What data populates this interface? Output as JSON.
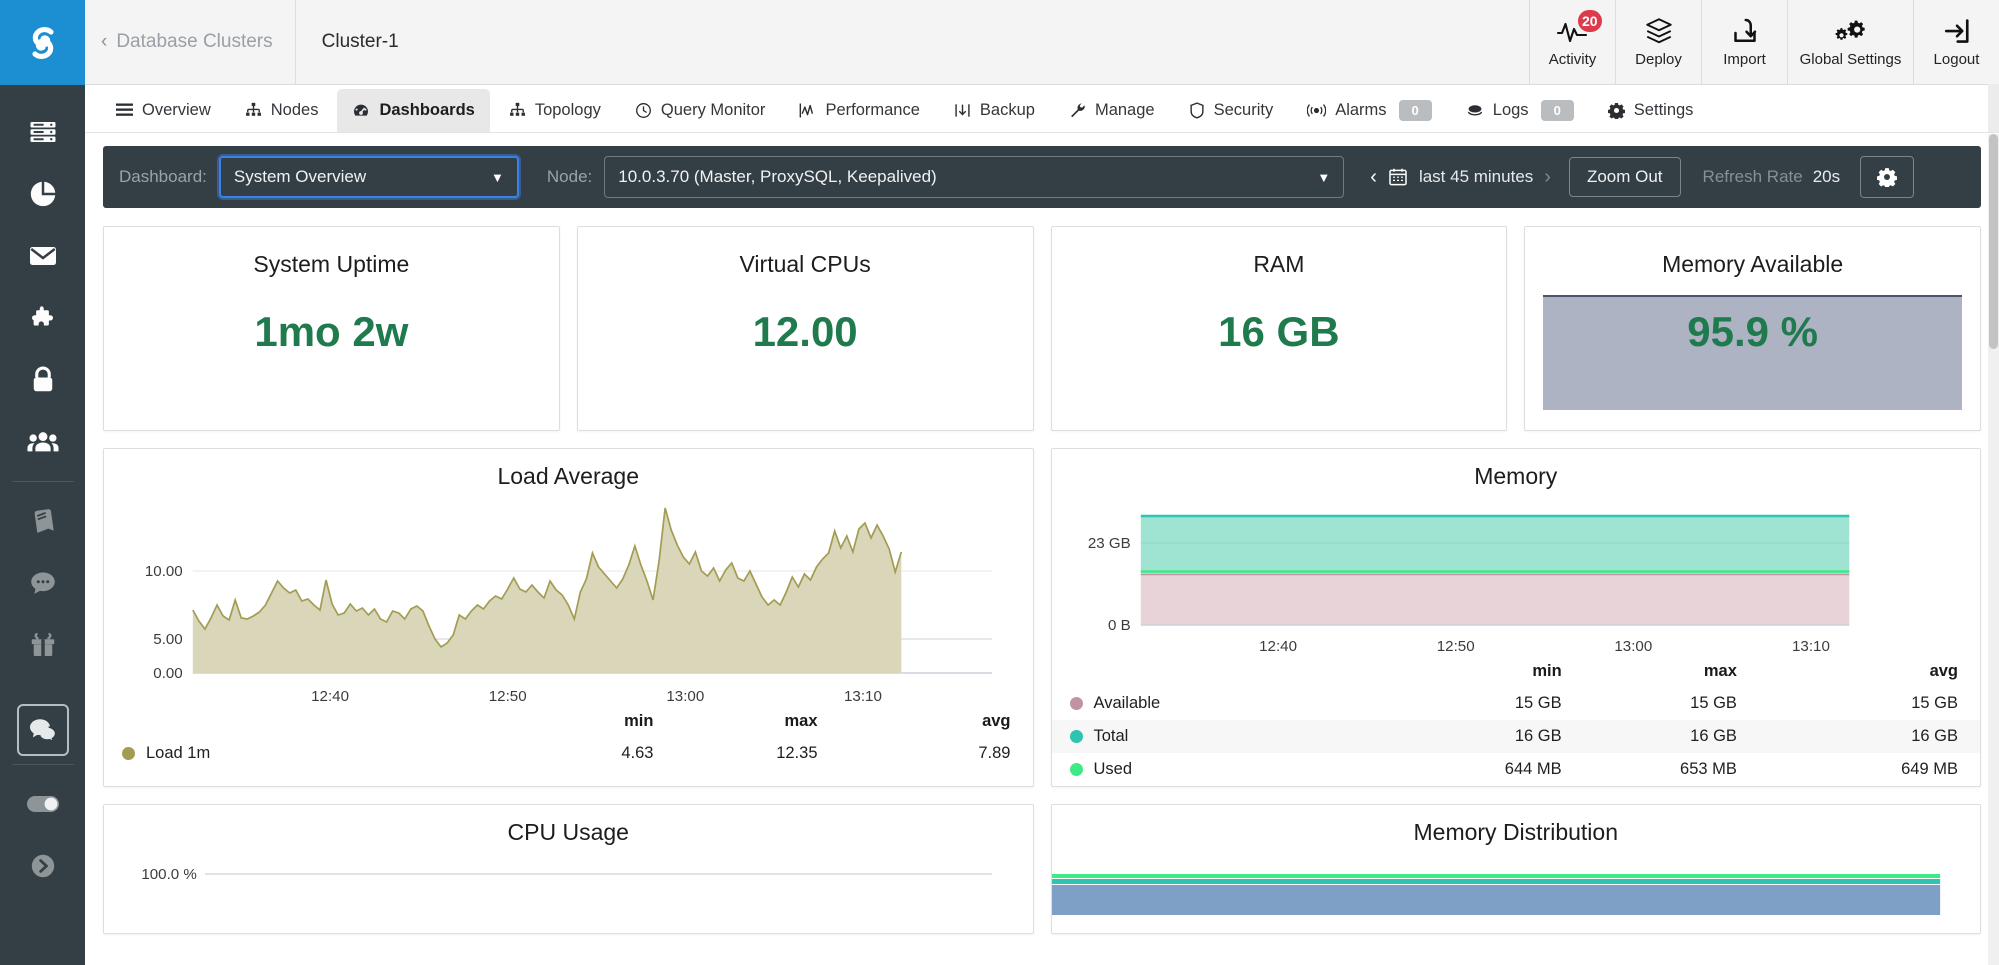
{
  "sidebar": {
    "logo_icon": "severalnines-logo-icon",
    "items": [
      {
        "icon": "database-server-icon",
        "name": "clusters"
      },
      {
        "icon": "pie-chart-icon",
        "name": "reports"
      },
      {
        "icon": "envelope-icon",
        "name": "email-notifications"
      },
      {
        "icon": "puzzle-piece-icon",
        "name": "integrations"
      },
      {
        "icon": "lock-icon",
        "name": "key-management"
      },
      {
        "icon": "users-icon",
        "name": "user-management"
      },
      {
        "icon": "book-icon",
        "name": "documentation"
      },
      {
        "icon": "comment-dots-icon",
        "name": "support"
      },
      {
        "icon": "gift-icon",
        "name": "whats-new"
      }
    ],
    "active_item": {
      "icon": "comments-icon",
      "name": "chat"
    },
    "bottom_items": [
      {
        "icon": "toggle-icon",
        "name": "theme-toggle"
      },
      {
        "icon": "chevron-right-circle-icon",
        "name": "expand-sidebar"
      }
    ]
  },
  "header": {
    "back_chevron": "‹",
    "breadcrumb_parent": "Database Clusters",
    "cluster_title": "Cluster-1",
    "actions": [
      {
        "label": "Activity",
        "icon": "activity-pulse-icon",
        "badge": "20"
      },
      {
        "label": "Deploy",
        "icon": "stack-layers-icon",
        "badge": ""
      },
      {
        "label": "Import",
        "icon": "import-download-icon",
        "badge": ""
      },
      {
        "label": "Global Settings",
        "icon": "gears-icon",
        "badge": ""
      },
      {
        "label": "Logout",
        "icon": "logout-arrow-icon",
        "badge": ""
      }
    ]
  },
  "nav": {
    "tabs": [
      {
        "label": "Overview",
        "icon": "list-icon",
        "active": false,
        "count": null
      },
      {
        "label": "Nodes",
        "icon": "sitemap-icon",
        "active": false,
        "count": null
      },
      {
        "label": "Dashboards",
        "icon": "dashboard-gauge-icon",
        "active": true,
        "count": null
      },
      {
        "label": "Topology",
        "icon": "topology-icon",
        "active": false,
        "count": null
      },
      {
        "label": "Query Monitor",
        "icon": "clock-icon",
        "active": false,
        "count": null
      },
      {
        "label": "Performance",
        "icon": "chart-line-icon",
        "active": false,
        "count": null
      },
      {
        "label": "Backup",
        "icon": "backup-download-icon",
        "active": false,
        "count": null
      },
      {
        "label": "Manage",
        "icon": "wrench-icon",
        "active": false,
        "count": null
      },
      {
        "label": "Security",
        "icon": "shield-icon",
        "active": false,
        "count": null
      },
      {
        "label": "Alarms",
        "icon": "broadcast-icon",
        "active": false,
        "count": "0"
      },
      {
        "label": "Logs",
        "icon": "logs-icon",
        "active": false,
        "count": "0"
      },
      {
        "label": "Settings",
        "icon": "gear-icon",
        "active": false,
        "count": null
      }
    ]
  },
  "controls": {
    "dashboard_label": "Dashboard:",
    "dashboard_value": "System Overview",
    "node_label": "Node:",
    "node_value": "10.0.3.70 (Master, ProxySQL, Keepalived)",
    "prev_arrow": "‹",
    "next_arrow": "›",
    "calendar_icon": "calendar-icon",
    "time_range": "last 45 minutes",
    "zoom_out_label": "Zoom Out",
    "refresh_rate_label": "Refresh Rate",
    "refresh_rate_value": "20s",
    "settings_icon": "gear-icon"
  },
  "stats": [
    {
      "title": "System Uptime",
      "value": "1mo 2w",
      "filled": false
    },
    {
      "title": "Virtual CPUs",
      "value": "12.00",
      "filled": false
    },
    {
      "title": "RAM",
      "value": "16 GB",
      "filled": false
    },
    {
      "title": "Memory Available",
      "value": "95.9 %",
      "filled": true
    }
  ],
  "panels": {
    "load_average": {
      "title": "Load Average",
      "columns": [
        "min",
        "max",
        "avg"
      ],
      "rows": [
        {
          "name": "Load 1m",
          "color": "#a39d53",
          "min": "4.63",
          "max": "12.35",
          "avg": "7.89"
        }
      ]
    },
    "memory": {
      "title": "Memory",
      "columns": [
        "min",
        "max",
        "avg"
      ],
      "rows": [
        {
          "name": "Available",
          "color": "#c194a5",
          "min": "15 GB",
          "max": "15 GB",
          "avg": "15 GB"
        },
        {
          "name": "Total",
          "color": "#2ec4b0",
          "min": "16 GB",
          "max": "16 GB",
          "avg": "16 GB"
        },
        {
          "name": "Used",
          "color": "#3ceb86",
          "min": "644 MB",
          "max": "653 MB",
          "avg": "649 MB"
        }
      ]
    },
    "cpu_usage": {
      "title": "CPU Usage",
      "top_tick": "100.0 %"
    },
    "memory_distribution": {
      "title": "Memory Distribution"
    }
  },
  "chart_data": [
    {
      "type": "area",
      "title": "Load Average",
      "xlabel": "",
      "ylabel": "",
      "ylim": [
        0,
        13
      ],
      "yticks": [
        "0.00",
        "5.00",
        "10.00"
      ],
      "ytick_values": [
        0,
        5,
        10
      ],
      "xticks": [
        "12:40",
        "12:50",
        "13:00",
        "13:10"
      ],
      "grid": true,
      "legend_position": "below-table",
      "series": [
        {
          "name": "Load 1m",
          "color": "#a39d53",
          "min": 4.63,
          "max": 12.35,
          "avg": 7.89,
          "values": [
            6.7,
            6.1,
            5.8,
            6.3,
            7.0,
            6.4,
            6.2,
            7.2,
            6.4,
            6.3,
            6.5,
            6.7,
            7.0,
            7.6,
            8.2,
            7.8,
            7.5,
            7.7,
            7.1,
            7.2,
            6.9,
            6.6,
            8.7,
            6.9,
            6.4,
            6.5,
            7.0,
            6.6,
            6.8,
            6.4,
            6.7,
            6.2,
            6.0,
            6.6,
            6.5,
            6.2,
            6.7,
            6.9,
            6.6,
            5.9,
            5.2,
            4.8,
            5.0,
            5.4,
            6.4,
            6.2,
            6.6,
            6.9,
            6.7,
            7.1,
            7.4,
            7.2,
            7.8,
            8.4,
            7.8,
            7.6,
            8.0,
            7.6,
            7.3,
            8.2,
            7.7,
            7.4,
            6.9,
            6.2,
            7.6,
            8.3,
            9.8,
            9.0,
            8.6,
            8.2,
            7.8,
            8.3,
            9.1,
            10.2,
            9.2,
            8.3,
            7.3,
            9.6,
            12.3,
            11.1,
            10.3,
            9.6,
            9.2,
            9.9,
            8.8,
            8.5,
            9.0,
            8.3,
            8.9,
            9.3,
            8.4,
            8.2,
            8.8,
            8.1,
            7.4,
            6.9,
            7.2,
            6.9,
            7.7,
            8.6,
            8.0,
            8.7,
            8.3,
            9.0,
            9.4,
            9.7,
            10.9,
            10.0,
            10.6,
            9.8,
            11.0,
            11.3,
            10.4,
            11.1,
            10.5,
            9.8,
            8.6,
            9.6
          ]
        }
      ]
    },
    {
      "type": "area",
      "title": "Memory",
      "xlabel": "",
      "ylabel": "",
      "ylim": [
        0,
        23
      ],
      "yticks": [
        "0 B",
        "23 GB"
      ],
      "ytick_values": [
        0,
        23
      ],
      "xticks": [
        "12:40",
        "12:50",
        "13:00",
        "13:10"
      ],
      "grid": true,
      "series": [
        {
          "name": "Available",
          "color": "#c194a5",
          "min": "15 GB",
          "max": "15 GB",
          "avg": "15 GB",
          "constant_gb": 15
        },
        {
          "name": "Total",
          "color": "#2ec4b0",
          "min": "16 GB",
          "max": "16 GB",
          "avg": "16 GB",
          "constant_gb": 16
        },
        {
          "name": "Used",
          "color": "#3ceb86",
          "min": "644 MB",
          "max": "653 MB",
          "avg": "649 MB",
          "constant_gb": 0.64
        }
      ]
    },
    {
      "type": "area",
      "title": "CPU Usage",
      "yticks": [
        "100.0 %"
      ],
      "ytick_values": [
        100
      ],
      "ylim": [
        0,
        100
      ],
      "grid": true,
      "series": []
    },
    {
      "type": "area",
      "title": "Memory Distribution",
      "grid": true,
      "series": [
        {
          "name": "band-green",
          "color": "#3ceb86"
        },
        {
          "name": "band-teal",
          "color": "#2ec4b0"
        },
        {
          "name": "band-blue",
          "color": "#7e9fc6"
        }
      ]
    }
  ],
  "colors": {
    "brand_blue": "#1b8fd1",
    "sidebar_dark": "#343f45",
    "accent_green": "#1f7a4d",
    "badge_red": "#dd3b4b",
    "focus_blue": "#3b82e6"
  }
}
